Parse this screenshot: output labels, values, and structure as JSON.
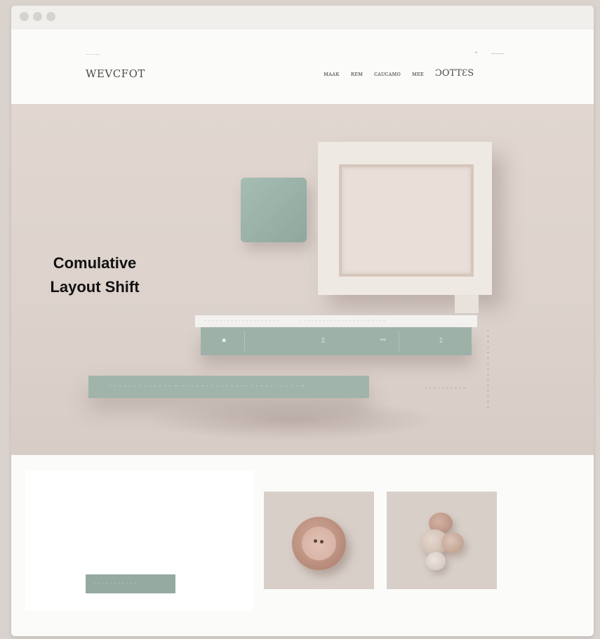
{
  "window": {
    "dots": [
      "window-dot-1",
      "window-dot-2",
      "window-dot-3"
    ]
  },
  "header": {
    "logo_small": "………",
    "logo": "WEVCFOT",
    "util_links": [
      "ʼ⁹",
      "———"
    ],
    "nav": [
      "ᴍᴀᴀᴋ",
      "ʀᴇᴍ",
      "ᴄᴀᴜᴄᴀᴍᴏ",
      "ᴍᴇᴇ",
      "ƆOTTƐS"
    ]
  },
  "hero": {
    "strip_left": "- - - - - - - - - - - - - - - - - - - -",
    "strip_right": "- - - - - - - - - - - - - - - - - - - - - - -",
    "bar_icons": [
      "▪",
      "▯",
      "⚯",
      "▯"
    ],
    "cta_text": "- - - - - - - - - - - - - — - - - - - - - - - - - - - - - - - - - - - - - - —",
    "side_label": "- - - - - - - - - -",
    "vertical_text": "- - - - - - - - - - - - - - -"
  },
  "overlay": {
    "line1": "Comulative",
    "line2": "Layout Shift"
  },
  "content": {
    "button_label": "- - - - - - - - - - -"
  },
  "colors": {
    "accent_green": "#9db1a8",
    "hero_background": "#ddd2cc",
    "overlay_text": "#111111"
  }
}
